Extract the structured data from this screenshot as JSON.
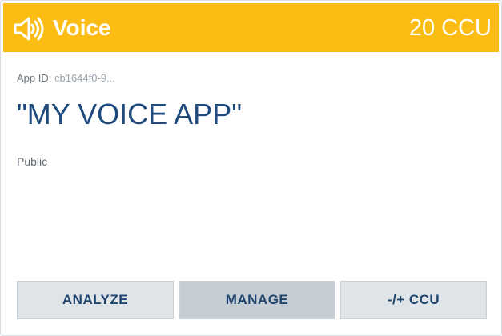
{
  "header": {
    "icon": "speaker-icon",
    "title": "Voice",
    "ccu": "20 CCU",
    "background_color": "#fbbd14"
  },
  "app": {
    "id_label": "App ID:",
    "id_value": "cb1644f0-9...",
    "name": "\"MY VOICE APP\"",
    "visibility": "Public"
  },
  "actions": {
    "analyze": "ANALYZE",
    "manage": "MANAGE",
    "ccu": "-/+ CCU"
  }
}
